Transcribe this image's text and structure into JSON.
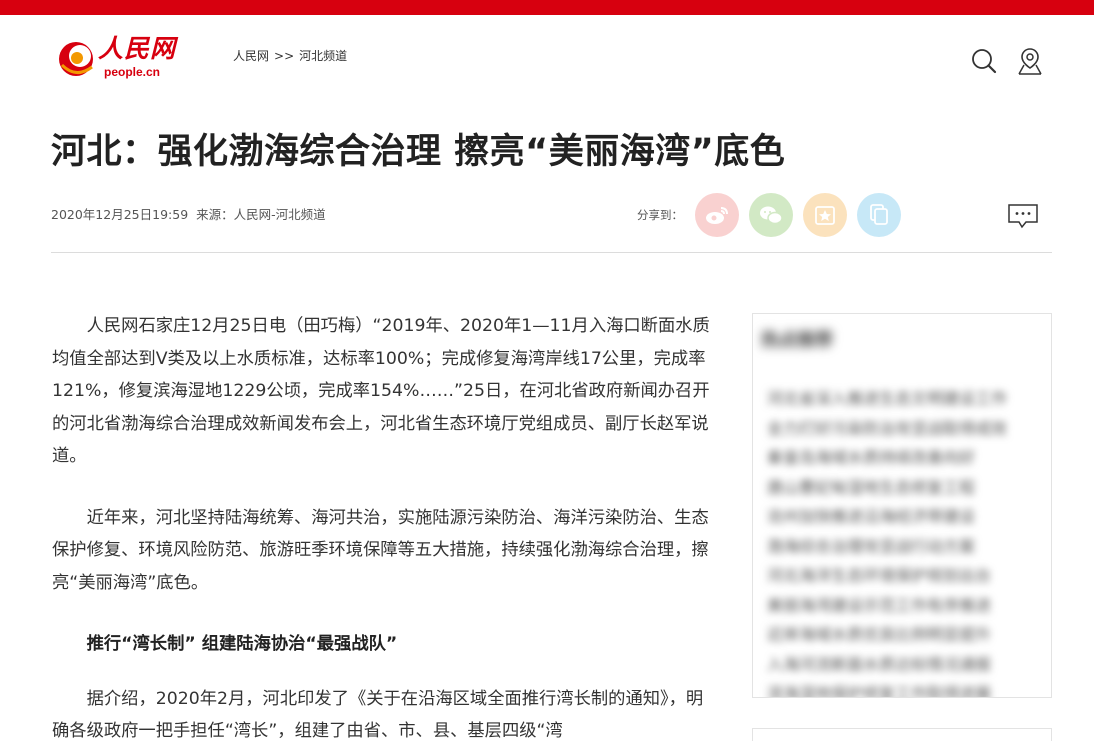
{
  "header": {
    "logo_text": "人民网",
    "logo_sub": "people.cn",
    "breadcrumb": [
      "人民网",
      ">>",
      "河北频道"
    ],
    "accent_color": "#d7000f",
    "icons": [
      "search-icon",
      "location-icon"
    ]
  },
  "article": {
    "title": "河北：强化渤海综合治理 擦亮“美丽海湾”底色",
    "date": "2020年12月25日19:59",
    "source": "来源：人民网-河北频道",
    "share_label": "分享到：",
    "share_buttons": [
      "weibo-icon",
      "wechat-icon",
      "favorite-icon",
      "copy-icon"
    ],
    "paragraphs": [
      "人民网石家庄12月25日电（田巧梅）“2019年、2020年1—11月入海口断面水质均值全部达到V类及以上水质标准，达标率100%；完成修复海湾岸线17公里，完成率121%，修复滨海湿地1229公顷，完成率154%……”25日，在河北省政府新闻办召开的河北省渤海综合治理成效新闻发布会上，河北省生态环境厅党组成员、副厅长赵军说道。",
      "近年来，河北坚持陆海统筹、海河共治，实施陆源污染防治、海洋污染防治、生态保护修复、环境风险防范、旅游旺季环境保障等五大措施，持续强化渤海综合治理，擦亮“美丽海湾”底色。",
      "推行“湾长制” 组建陆海协治“最强战队”",
      "据介绍，2020年2月，河北印发了《关于在沿海区域全面推行湾长制的通知》，明确各级政府一把手担任“湾长”，组建了由省、市、县、基层四级“湾"
    ]
  },
  "sidebar": {
    "title": "热点推荐",
    "items": [
      "河北省深入推进生态文明建设工作",
      "全力打好污染防治攻坚战取得成效",
      "秦皇岛海域水质持续改善向好",
      "唐山曹妃甸湿地生态修复工程",
      "沧州加快推进沿海经济带建设",
      "渤海综合治理攻坚战行动方案",
      "河北海洋生态环境保护规划出台",
      "美丽海湾建设示范工作有序推进",
      "近岸海域水质优良比例明显提升",
      "入海河流断面水质达标情况通报",
      "滨海湿地保护修复工作取得进展"
    ]
  }
}
